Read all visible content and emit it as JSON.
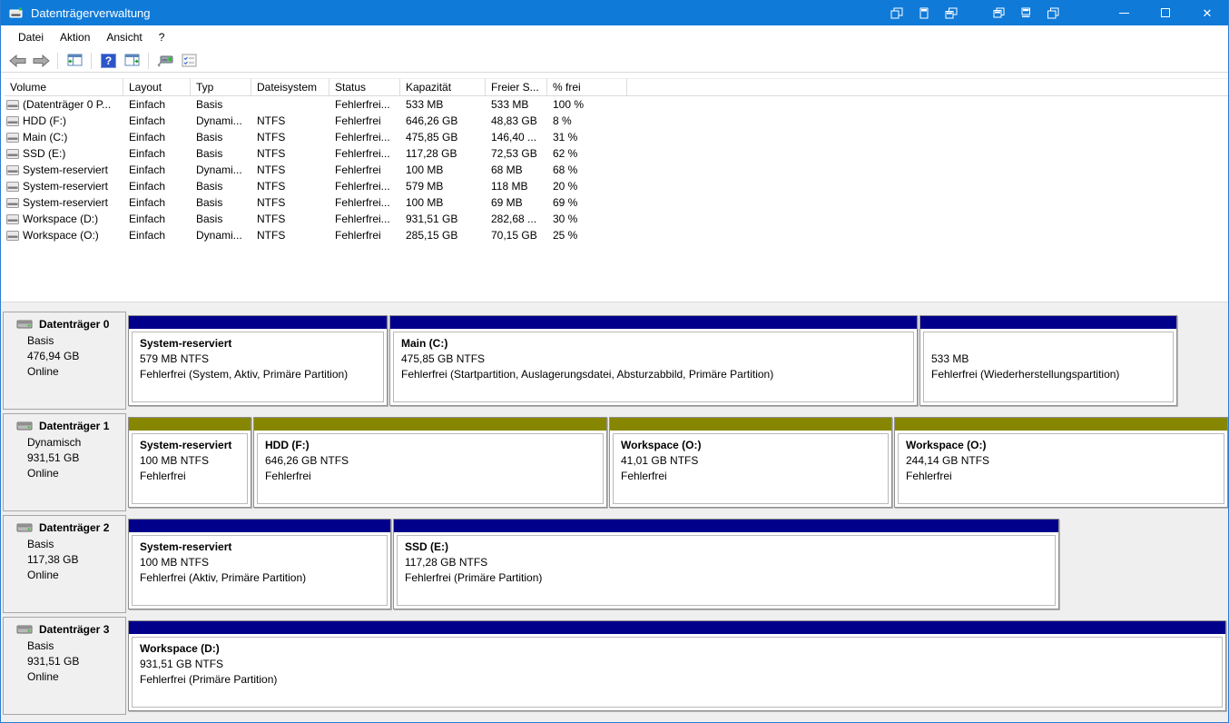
{
  "window": {
    "title": "Datenträgerverwaltung"
  },
  "colors": {
    "titlebar": "#0f7ad8",
    "partition_primary": "#00008b",
    "partition_dynamic": "#868600",
    "pane_background": "#efefef"
  },
  "menu": {
    "items": [
      "Datei",
      "Aktion",
      "Ansicht",
      "?"
    ]
  },
  "toolbar": {
    "icons": [
      "back-icon",
      "forward-icon",
      "console-tree-icon",
      "help-icon",
      "action-pane-icon",
      "properties-icon",
      "checklist-icon"
    ]
  },
  "table": {
    "columns": [
      "Volume",
      "Layout",
      "Typ",
      "Dateisystem",
      "Status",
      "Kapazität",
      "Freier S...",
      "% frei"
    ],
    "rows": [
      {
        "volume": "(Datenträger 0 P...",
        "layout": "Einfach",
        "typ": "Basis",
        "dateisystem": "",
        "status": "Fehlerfrei...",
        "kapazitaet": "533 MB",
        "freier": "533 MB",
        "frei_pct": "100 %"
      },
      {
        "volume": "HDD (F:)",
        "layout": "Einfach",
        "typ": "Dynami...",
        "dateisystem": "NTFS",
        "status": "Fehlerfrei",
        "kapazitaet": "646,26 GB",
        "freier": "48,83 GB",
        "frei_pct": "8 %"
      },
      {
        "volume": "Main (C:)",
        "layout": "Einfach",
        "typ": "Basis",
        "dateisystem": "NTFS",
        "status": "Fehlerfrei...",
        "kapazitaet": "475,85 GB",
        "freier": "146,40 ...",
        "frei_pct": "31 %"
      },
      {
        "volume": "SSD (E:)",
        "layout": "Einfach",
        "typ": "Basis",
        "dateisystem": "NTFS",
        "status": "Fehlerfrei...",
        "kapazitaet": "117,28 GB",
        "freier": "72,53 GB",
        "frei_pct": "62 %"
      },
      {
        "volume": "System-reserviert",
        "layout": "Einfach",
        "typ": "Dynami...",
        "dateisystem": "NTFS",
        "status": "Fehlerfrei",
        "kapazitaet": "100 MB",
        "freier": "68 MB",
        "frei_pct": "68 %"
      },
      {
        "volume": "System-reserviert",
        "layout": "Einfach",
        "typ": "Basis",
        "dateisystem": "NTFS",
        "status": "Fehlerfrei...",
        "kapazitaet": "579 MB",
        "freier": "118 MB",
        "frei_pct": "20 %"
      },
      {
        "volume": "System-reserviert",
        "layout": "Einfach",
        "typ": "Basis",
        "dateisystem": "NTFS",
        "status": "Fehlerfrei...",
        "kapazitaet": "100 MB",
        "freier": "69 MB",
        "frei_pct": "69 %"
      },
      {
        "volume": "Workspace (D:)",
        "layout": "Einfach",
        "typ": "Basis",
        "dateisystem": "NTFS",
        "status": "Fehlerfrei...",
        "kapazitaet": "931,51 GB",
        "freier": "282,68 ...",
        "frei_pct": "30 %"
      },
      {
        "volume": "Workspace (O:)",
        "layout": "Einfach",
        "typ": "Dynami...",
        "dateisystem": "NTFS",
        "status": "Fehlerfrei",
        "kapazitaet": "285,15 GB",
        "freier": "70,15 GB",
        "frei_pct": "25 %"
      }
    ]
  },
  "disks": [
    {
      "name": "Datenträger 0",
      "type": "Basis",
      "size": "476,94 GB",
      "status": "Online",
      "partitions": [
        {
          "title": "System-reserviert",
          "line2": "579 MB NTFS",
          "line3": "Fehlerfrei (System, Aktiv, Primäre Partition)"
        },
        {
          "title": "Main  (C:)",
          "line2": "475,85 GB NTFS",
          "line3": "Fehlerfrei (Startpartition, Auslagerungsdatei, Absturzabbild, Primäre Partition)"
        },
        {
          "title": "",
          "line2": "533 MB",
          "line3": "Fehlerfrei (Wiederherstellungspartition)"
        }
      ]
    },
    {
      "name": "Datenträger 1",
      "type": "Dynamisch",
      "size": "931,51 GB",
      "status": "Online",
      "partitions": [
        {
          "title": "System-reserviert",
          "line2": "100 MB NTFS",
          "line3": "Fehlerfrei"
        },
        {
          "title": "HDD  (F:)",
          "line2": "646,26 GB NTFS",
          "line3": "Fehlerfrei"
        },
        {
          "title": "Workspace  (O:)",
          "line2": "41,01 GB NTFS",
          "line3": "Fehlerfrei"
        },
        {
          "title": "Workspace  (O:)",
          "line2": "244,14 GB NTFS",
          "line3": "Fehlerfrei"
        }
      ]
    },
    {
      "name": "Datenträger 2",
      "type": "Basis",
      "size": "117,38 GB",
      "status": "Online",
      "partitions": [
        {
          "title": "System-reserviert",
          "line2": "100 MB NTFS",
          "line3": "Fehlerfrei (Aktiv, Primäre Partition)"
        },
        {
          "title": "SSD  (E:)",
          "line2": "117,28 GB NTFS",
          "line3": "Fehlerfrei (Primäre Partition)"
        }
      ]
    },
    {
      "name": "Datenträger 3",
      "type": "Basis",
      "size": "931,51 GB",
      "status": "Online",
      "partitions": [
        {
          "title": "Workspace  (D:)",
          "line2": "931,51 GB NTFS",
          "line3": "Fehlerfrei (Primäre Partition)"
        }
      ]
    }
  ]
}
